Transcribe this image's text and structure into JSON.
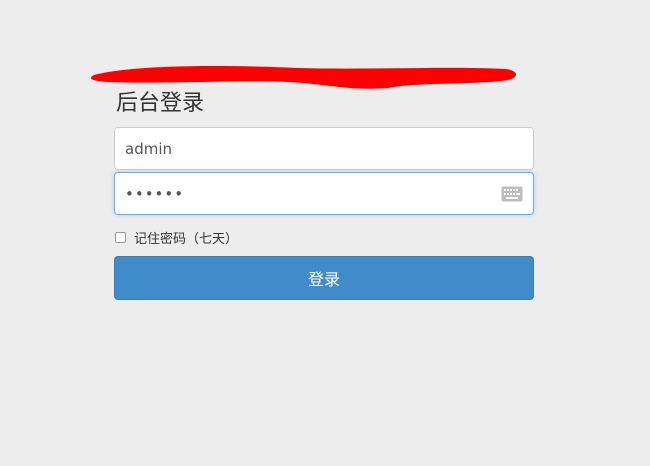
{
  "login": {
    "title": "后台登录",
    "username_value": "admin",
    "password_value": "••••••",
    "remember_label": "记住密码（七天）",
    "remember_checked": false,
    "submit_label": "登录",
    "keyboard_icon": "keyboard-icon"
  },
  "colors": {
    "background": "#ededed",
    "button": "#428bca",
    "redaction": "#ff0000"
  }
}
